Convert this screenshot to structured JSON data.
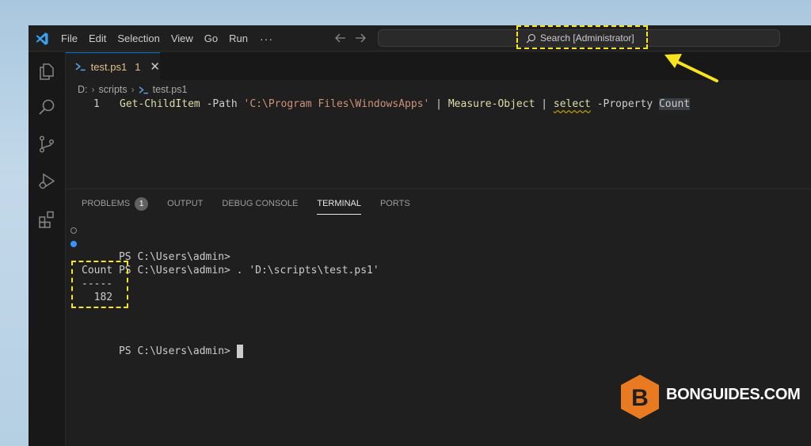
{
  "menu": {
    "items": [
      "File",
      "Edit",
      "Selection",
      "View",
      "Go",
      "Run"
    ],
    "more": "···"
  },
  "search": {
    "label": "Search [Administrator]"
  },
  "tab": {
    "name": "test.ps1",
    "problems": "1",
    "close": "✕"
  },
  "breadcrumb": {
    "drive": "D:",
    "folder": "scripts",
    "file": "test.ps1"
  },
  "editor": {
    "line_number": "1",
    "tokens": {
      "cmd1": "Get-ChildItem",
      "p1": " -Path ",
      "str": "'C:\\Program Files\\WindowsApps'",
      "pipe1": " | ",
      "cmd2": "Measure-Object",
      "pipe2": " | ",
      "cmd3": "select",
      "p2": " -Property ",
      "count": "Count"
    }
  },
  "panel": {
    "tabs": [
      "PROBLEMS",
      "OUTPUT",
      "DEBUG CONSOLE",
      "TERMINAL",
      "PORTS"
    ],
    "problems_badge": "1",
    "active_tab": "TERMINAL"
  },
  "terminal": {
    "line1": "PS C:\\Users\\admin>",
    "line2": "PS C:\\Users\\admin> . 'D:\\scripts\\test.ps1'",
    "header": "Count",
    "dashes": "-----",
    "value": "  182",
    "prompt": "PS C:\\Users\\admin> "
  },
  "watermark": {
    "text": "BONGUIDES.COM",
    "letter": "B"
  },
  "colors": {
    "accent": "#0078d4",
    "highlight": "#f6e51e",
    "logo": "#e87b21"
  }
}
